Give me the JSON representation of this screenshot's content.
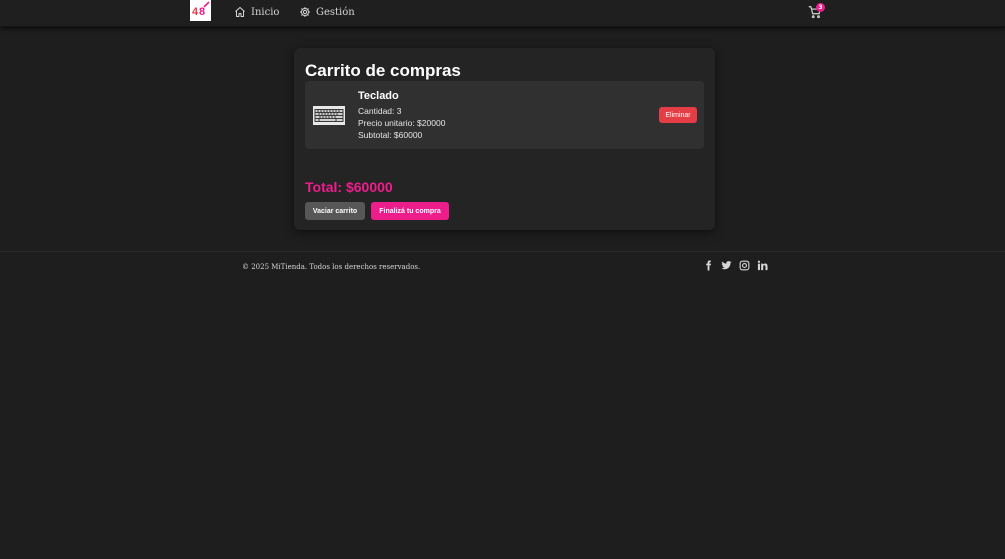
{
  "navbar": {
    "logo_icon": "brand-logo-icon",
    "links": [
      {
        "label": "Inicio",
        "icon": "home-icon"
      },
      {
        "label": "Gestión",
        "icon": "gear-icon"
      }
    ],
    "cart_count": "3",
    "cart_icon": "cart-icon"
  },
  "cart": {
    "title": "Carrito de compras",
    "items": [
      {
        "name": "Teclado",
        "quantity": "Cantidad: 3",
        "unit_price": "Precio unitario: $20000",
        "subtotal": "Subtotal: $60000",
        "thumb_icon": "keyboard-thumbnail",
        "remove_label": "Eliminar"
      }
    ],
    "total": "Total: $60000",
    "clear_label": "Vaciar carrito",
    "checkout_label": "Finalizá tu compra"
  },
  "footer": {
    "copyright": "© 2025 MiTienda. Todos los derechos reservados.",
    "social": [
      "facebook-icon",
      "twitter-icon",
      "instagram-icon",
      "linkedin-icon"
    ]
  },
  "colors": {
    "accent": "#ee1d8c",
    "danger": "#e53d45",
    "background": "#1f1e1f",
    "card": "#252425"
  }
}
